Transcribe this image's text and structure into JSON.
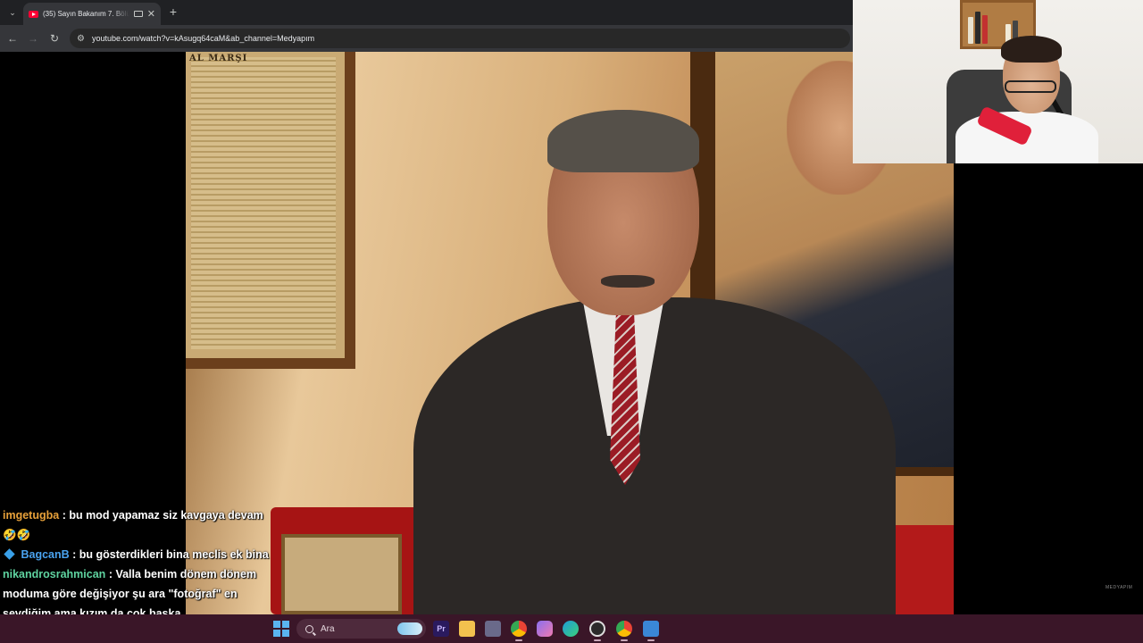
{
  "browser": {
    "tab": {
      "title": "(35) Sayın Bakanım 7. Bölüm",
      "close_glyph": "✕",
      "favicon": "youtube-icon"
    },
    "tab_list_glyph": "⌄",
    "new_tab_glyph": "+",
    "nav": {
      "back_glyph": "←",
      "forward_glyph": "→",
      "reload_glyph": "↻"
    },
    "site_info_glyph": "⚙",
    "url": "youtube.com/watch?v=kAsugq64caM&ab_channel=Medyapım"
  },
  "video": {
    "anthem_heading": "AL MARŞI",
    "watermark": "MEDYAPIM"
  },
  "chat": {
    "messages": [
      {
        "user": "imgetugba",
        "user_color": "#e8a13a",
        "text": ": bu mod yapamaz siz kavgaya devam 🤣🤣",
        "badge": false
      },
      {
        "user": "BagcanB",
        "user_color": "#4aa3f0",
        "text": ": bu gösterdikleri bina meclis ek bina",
        "badge": true
      },
      {
        "user": "nikandrosrahmican",
        "user_color": "#5fd3a0",
        "text": ": Valla benim dönem dönem moduma göre değişiyor şu ara \"fotoğraf\" en sevdiğim ama kızım da çok başka",
        "badge": false
      }
    ]
  },
  "taskbar": {
    "search_placeholder": "Ara",
    "apps": [
      {
        "name": "premiere-icon",
        "label": "Pr",
        "color": "#2a1a5e"
      },
      {
        "name": "file-explorer-icon",
        "label": "",
        "color": "#f2c14e"
      },
      {
        "name": "app-icon",
        "label": "",
        "color": "#6a6a8a"
      },
      {
        "name": "chrome-icon",
        "label": "",
        "color": "#ea4335"
      },
      {
        "name": "copilot-icon",
        "label": "",
        "color": "#8a6ff0"
      },
      {
        "name": "edge-icon",
        "label": "",
        "color": "#1f9bd8"
      },
      {
        "name": "obs-icon",
        "label": "",
        "color": "#2b2b2b"
      },
      {
        "name": "chrome-profile-icon",
        "label": "",
        "color": "#34a853"
      },
      {
        "name": "streaming-app-icon",
        "label": "",
        "color": "#3a87d6"
      }
    ]
  }
}
